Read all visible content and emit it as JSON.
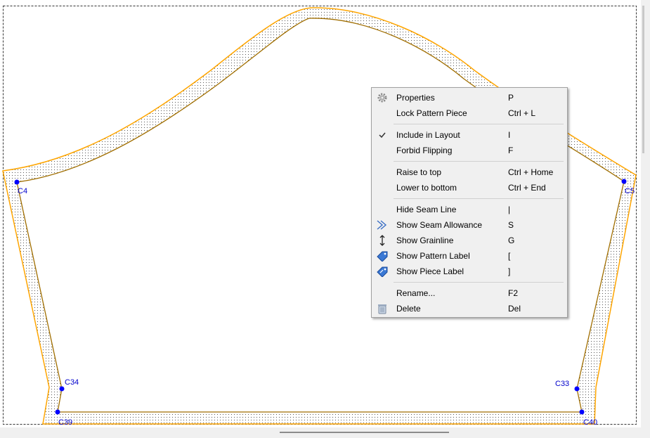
{
  "colors": {
    "seam_allowance": "#FFA500",
    "seam_line": "#A06E00",
    "point": "#0000FF",
    "point_label": "#0000CC",
    "menu_bg": "#F0F0F0"
  },
  "points": [
    "C4",
    "C5",
    "C34",
    "C33",
    "C39",
    "C40"
  ],
  "context_menu": {
    "items": [
      {
        "label": "Properties",
        "shortcut": "P",
        "icon": "gear-icon"
      },
      {
        "label": "Lock Pattern Piece",
        "shortcut": "Ctrl + L",
        "icon": ""
      },
      {
        "label": "Include in Layout",
        "shortcut": "I",
        "icon": "checkmark-icon",
        "checked": true
      },
      {
        "label": "Forbid Flipping",
        "shortcut": "F",
        "icon": ""
      },
      {
        "label": "Raise to top",
        "shortcut": "Ctrl + Home",
        "icon": ""
      },
      {
        "label": "Lower to bottom",
        "shortcut": "Ctrl + End",
        "icon": ""
      },
      {
        "label": "Hide Seam Line",
        "shortcut": "|",
        "icon": ""
      },
      {
        "label": "Show Seam Allowance",
        "shortcut": "S",
        "icon": "seam-allowance-icon"
      },
      {
        "label": "Show Grainline",
        "shortcut": "G",
        "icon": "grainline-icon"
      },
      {
        "label": "Show Pattern Label",
        "shortcut": "[",
        "icon": "pattern-label-icon"
      },
      {
        "label": "Show Piece Label",
        "shortcut": "]",
        "icon": "piece-label-icon"
      },
      {
        "label": "Rename...",
        "shortcut": "F2",
        "icon": ""
      },
      {
        "label": "Delete",
        "shortcut": "Del",
        "icon": "trash-icon"
      }
    ]
  }
}
